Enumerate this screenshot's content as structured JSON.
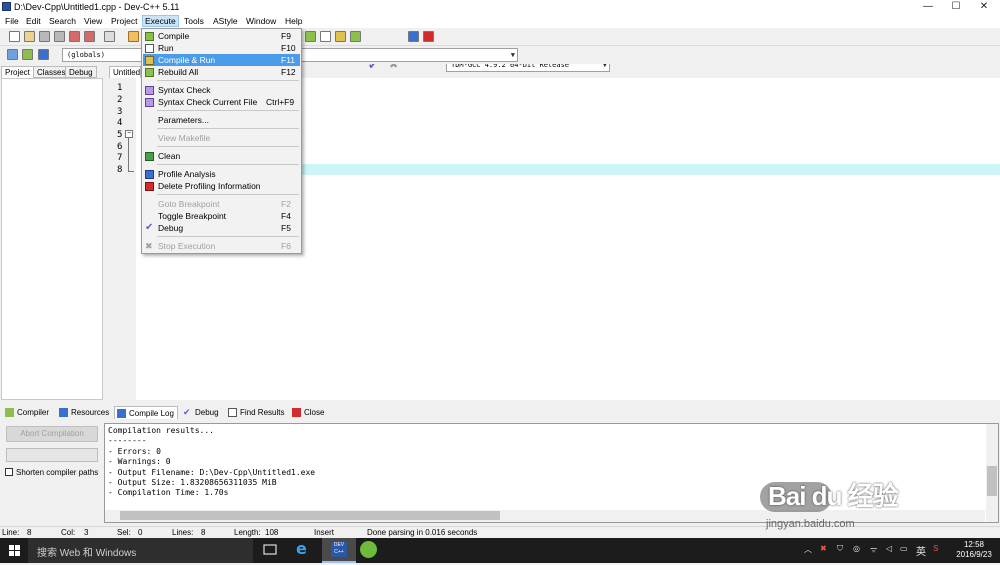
{
  "window": {
    "title": "D:\\Dev-Cpp\\Untitled1.cpp - Dev-C++ 5.11",
    "minimize": "—",
    "maximize": "☐",
    "close": "✕"
  },
  "menubar": [
    "File",
    "Edit",
    "Search",
    "View",
    "Project",
    "Execute",
    "Tools",
    "AStyle",
    "Window",
    "Help"
  ],
  "toolbar": {
    "compiler_combo": "TDM-GCC 4.9.2 64-bit Release",
    "scope_combo": "(globals)"
  },
  "left_tabs": [
    "Project",
    "Classes",
    "Debug"
  ],
  "editor": {
    "tab": "Untitled",
    "line_numbers": [
      "1",
      "2",
      "3",
      "4",
      "5",
      "6",
      "7",
      "8"
    ]
  },
  "execute_menu": {
    "items": [
      {
        "label": "Compile",
        "shortcut": "F9",
        "icon": "compile-icon",
        "state": "normal"
      },
      {
        "label": "Run",
        "shortcut": "F10",
        "icon": "run-icon",
        "state": "normal"
      },
      {
        "label": "Compile & Run",
        "shortcut": "F11",
        "icon": "compile-run-icon",
        "state": "highlighted"
      },
      {
        "label": "Rebuild All",
        "shortcut": "F12",
        "icon": "rebuild-icon",
        "state": "normal"
      },
      {
        "label": "Syntax Check",
        "shortcut": "",
        "icon": "syntax-check-icon",
        "state": "normal"
      },
      {
        "label": "Syntax Check Current File",
        "shortcut": "Ctrl+F9",
        "icon": "syntax-check-file-icon",
        "state": "normal"
      },
      {
        "label": "Parameters...",
        "shortcut": "",
        "icon": "",
        "state": "normal"
      },
      {
        "label": "View Makefile",
        "shortcut": "",
        "icon": "",
        "state": "disabled"
      },
      {
        "label": "Clean",
        "shortcut": "",
        "icon": "clean-icon",
        "state": "normal"
      },
      {
        "label": "Profile Analysis",
        "shortcut": "",
        "icon": "profile-icon",
        "state": "normal"
      },
      {
        "label": "Delete Profiling Information",
        "shortcut": "",
        "icon": "delete-profile-icon",
        "state": "normal"
      },
      {
        "label": "Goto Breakpoint",
        "shortcut": "F2",
        "icon": "",
        "state": "disabled"
      },
      {
        "label": "Toggle Breakpoint",
        "shortcut": "F4",
        "icon": "",
        "state": "normal"
      },
      {
        "label": "Debug",
        "shortcut": "F5",
        "icon": "debug-check-icon",
        "state": "normal"
      },
      {
        "label": "Stop Execution",
        "shortcut": "F6",
        "icon": "stop-icon",
        "state": "disabled"
      }
    ]
  },
  "bottom_tabs": [
    {
      "label": "Compiler",
      "icon": "compiler-icon"
    },
    {
      "label": "Resources",
      "icon": "resources-icon"
    },
    {
      "label": "Compile Log",
      "icon": "compile-log-icon",
      "selected": true
    },
    {
      "label": "Debug",
      "icon": "debug-icon"
    },
    {
      "label": "Find Results",
      "icon": "find-results-icon"
    },
    {
      "label": "Close",
      "icon": "close-icon"
    }
  ],
  "compile_panel": {
    "abort_button": "Abort Compilation",
    "shorten_paths": "Shorten compiler paths",
    "log": [
      "Compilation results...",
      "--------",
      "- Errors: 0",
      "- Warnings: 0",
      "- Output Filename: D:\\Dev-Cpp\\Untitled1.exe",
      "- Output Size: 1.83208656311035 MiB",
      "- Compilation Time: 1.70s"
    ]
  },
  "statusbar": {
    "line_label": "Line:",
    "line": "8",
    "col_label": "Col:",
    "col": "3",
    "sel_label": "Sel:",
    "sel": "0",
    "lines_label": "Lines:",
    "lines": "8",
    "length_label": "Length:",
    "length": "108",
    "mode": "Insert",
    "message": "Done parsing in 0.016 seconds"
  },
  "taskbar": {
    "search": "搜索 Web 和 Windows",
    "devcpp_label": "DEV C++",
    "tray_lang": "英",
    "time": "12:58",
    "date": "2016/9/23"
  },
  "watermark": {
    "logo": "Bai du 经验",
    "url": "jingyan.baidu.com"
  }
}
